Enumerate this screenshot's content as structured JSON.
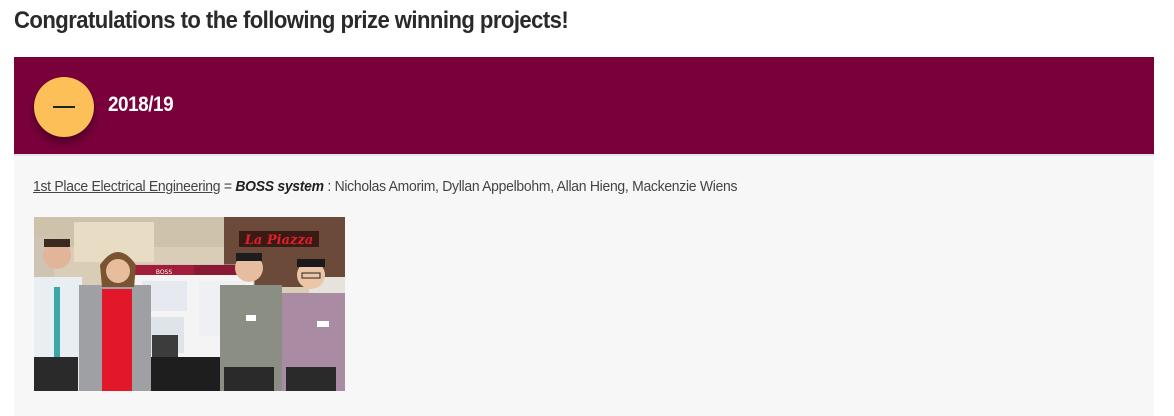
{
  "heading": "Congratulations to the following prize winning projects!",
  "accordion": {
    "year": "2018/19",
    "expanded": true,
    "toggle_icon": "minus-icon",
    "colors": {
      "header_bg": "#7a003c",
      "toggle_bg": "#fdbf57",
      "panel_bg": "#f7f7f7"
    },
    "entries": [
      {
        "prize_link": "1st Place Electrical Engineering",
        "separator": " = ",
        "project": "BOSS system",
        "team_separator": " : ",
        "members": "Nicholas Amorim, Dyllan Appelbohm, Allan Hieng, Mackenzie Wiens",
        "photo_alt": "Team photo with BOSS system poster"
      }
    ]
  },
  "photo": {
    "sign_text": "La Piazza",
    "poster_title": "BOSS"
  }
}
